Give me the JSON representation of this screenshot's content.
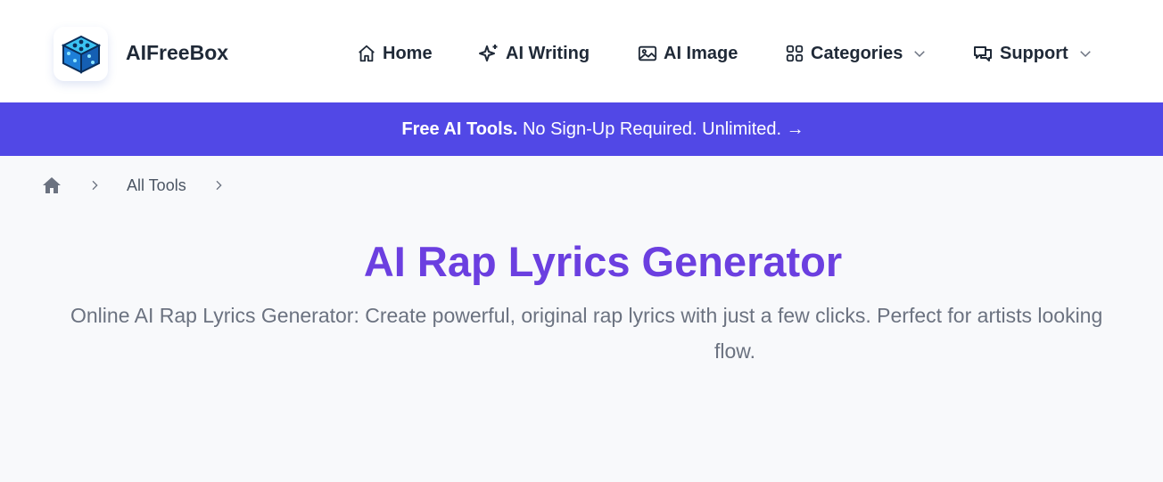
{
  "header": {
    "brand": "AIFreeBox",
    "nav": [
      {
        "label": "Home",
        "icon": "home-icon"
      },
      {
        "label": "AI Writing",
        "icon": "sparkles-icon"
      },
      {
        "label": "AI Image",
        "icon": "image-icon"
      },
      {
        "label": "Categories",
        "icon": "grid-icon",
        "dropdown": true
      },
      {
        "label": "Support",
        "icon": "chat-bubbles-icon",
        "dropdown": true
      }
    ]
  },
  "banner": {
    "bold": "Free AI Tools.",
    "text": " No Sign-Up Required. Unlimited. →",
    "color": "#5148e6"
  },
  "breadcrumb": {
    "home_icon": "home-icon",
    "items": [
      "All Tools"
    ]
  },
  "main": {
    "title": "AI Rap Lyrics Generator",
    "title_color": "#6b3fe0",
    "description_line1": "Online AI Rap Lyrics Generator: Create powerful, original rap lyrics with just a few clicks. Perfect for artists looking",
    "description_line2": "flow."
  }
}
